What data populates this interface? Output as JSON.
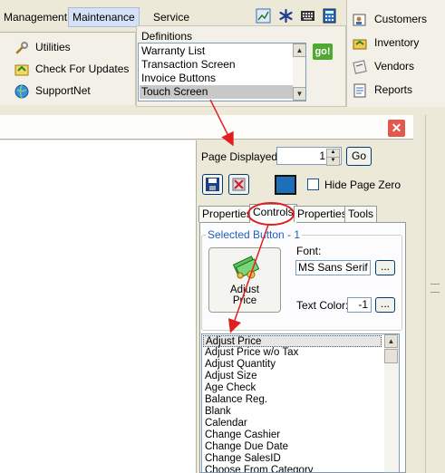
{
  "menu": {
    "items": [
      {
        "label": "Management",
        "active": false
      },
      {
        "label": "Maintenance",
        "active": true
      },
      {
        "label": "Service",
        "active": false
      }
    ]
  },
  "toolbar_icons": [
    "chart-icon",
    "snowflake-icon",
    "keyboard-icon",
    "calculator-icon"
  ],
  "left_panel": {
    "items": [
      {
        "label": "Utilities",
        "icon": "wrench-icon"
      },
      {
        "label": "Check For Updates",
        "icon": "update-icon"
      },
      {
        "label": "SupportNet",
        "icon": "globe-icon"
      }
    ]
  },
  "definitions": {
    "title": "Definitions",
    "items": [
      "Warranty List",
      "Transaction Screen",
      "Invoice Buttons",
      "Touch Screen"
    ],
    "selected": "Touch Screen",
    "go_label": "go!"
  },
  "right_panel": {
    "items": [
      {
        "label": "Customers",
        "icon": "customers-icon"
      },
      {
        "label": "Inventory",
        "icon": "inventory-icon"
      },
      {
        "label": "Vendors",
        "icon": "vendors-icon"
      },
      {
        "label": "Reports",
        "icon": "reports-icon"
      }
    ]
  },
  "window": {
    "close_label": "✕"
  },
  "page_displayed": {
    "label": "Page Displayed:",
    "value": "1",
    "go_label": "Go",
    "hide_page_zero_label": "Hide Page Zero",
    "hide_page_zero_checked": false
  },
  "tabs": [
    {
      "label": "Properties",
      "selected": false
    },
    {
      "label": "Controls",
      "selected": true
    },
    {
      "label": "Properties",
      "selected": false
    },
    {
      "label": "Tools",
      "selected": false
    }
  ],
  "selected_button": {
    "title": "Selected Button - 1",
    "button_label_line1": "Adjust",
    "button_label_line2": "Price",
    "font_label": "Font:",
    "font_value": "MS Sans Serif",
    "text_color_label": "Text Color:",
    "text_color_value": "-1",
    "ellipsis_label": "..."
  },
  "controls_list": {
    "items": [
      "Adjust Price",
      "Adjust Price w/o Tax",
      "Adjust Quantity",
      "Adjust Size",
      "Age Check",
      "Balance Reg.",
      "Blank",
      "Calendar",
      "Change Cashier",
      "Change Due Date",
      "Change SalesID",
      "Choose From Category"
    ],
    "selected": "Adjust Price"
  },
  "colors": {
    "annotation": "#e02020",
    "selection_blue": "#1c6fb8",
    "go_green": "#4fa832"
  }
}
